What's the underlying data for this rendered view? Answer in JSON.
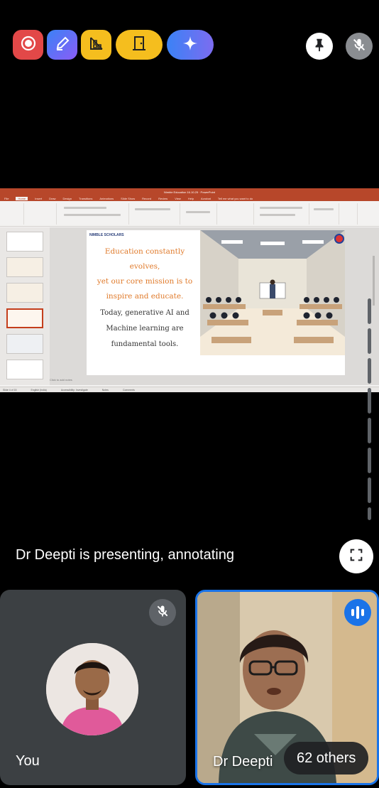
{
  "toolbar": {
    "record_icon": "record-icon",
    "annotate_icon": "annotate-pen-icon",
    "layout_icon": "layout-grid-icon",
    "leave_icon": "door-exit-icon",
    "gemini_icon": "sparkle-icon",
    "pin_icon": "pin-icon",
    "mute_icon": "mic-off-icon"
  },
  "share": {
    "app_title": "Nimble Education 16.10.25 · PowerPoint",
    "menu": [
      "File",
      "Home",
      "Insert",
      "Draw",
      "Design",
      "Transitions",
      "Animations",
      "Slide Show",
      "Record",
      "Review",
      "View",
      "Help",
      "Acrobat"
    ],
    "search_hint": "Tell me what you want to do",
    "slide": {
      "brand": "NIMBLE SCHOLARS",
      "orange_lines": [
        "Education constantly evolves,",
        "yet our core mission is to",
        "inspire and educate."
      ],
      "dark_lines": [
        "Today, generative AI and",
        "Machine learning are",
        "fundamental tools."
      ]
    },
    "notes_hint": "Click to add notes",
    "status": [
      "Slide 4 of 15",
      "English (India)",
      "Accessibility: Investigate",
      "Notes",
      "Comments"
    ]
  },
  "presenting": {
    "label": "Dr Deepti is presenting, annotating",
    "fullscreen_icon": "fullscreen-icon"
  },
  "tiles": {
    "you": {
      "name": "You",
      "mute_icon": "mic-off-icon"
    },
    "deepti": {
      "name": "Dr Deepti",
      "speaking_icon": "audio-level-icon"
    },
    "others_label": "62 others"
  },
  "colors": {
    "record": "#e24848",
    "accent_yellow": "#f5be1e",
    "accent_blue": "#1a73e8",
    "tile_dark": "#3c4043"
  }
}
